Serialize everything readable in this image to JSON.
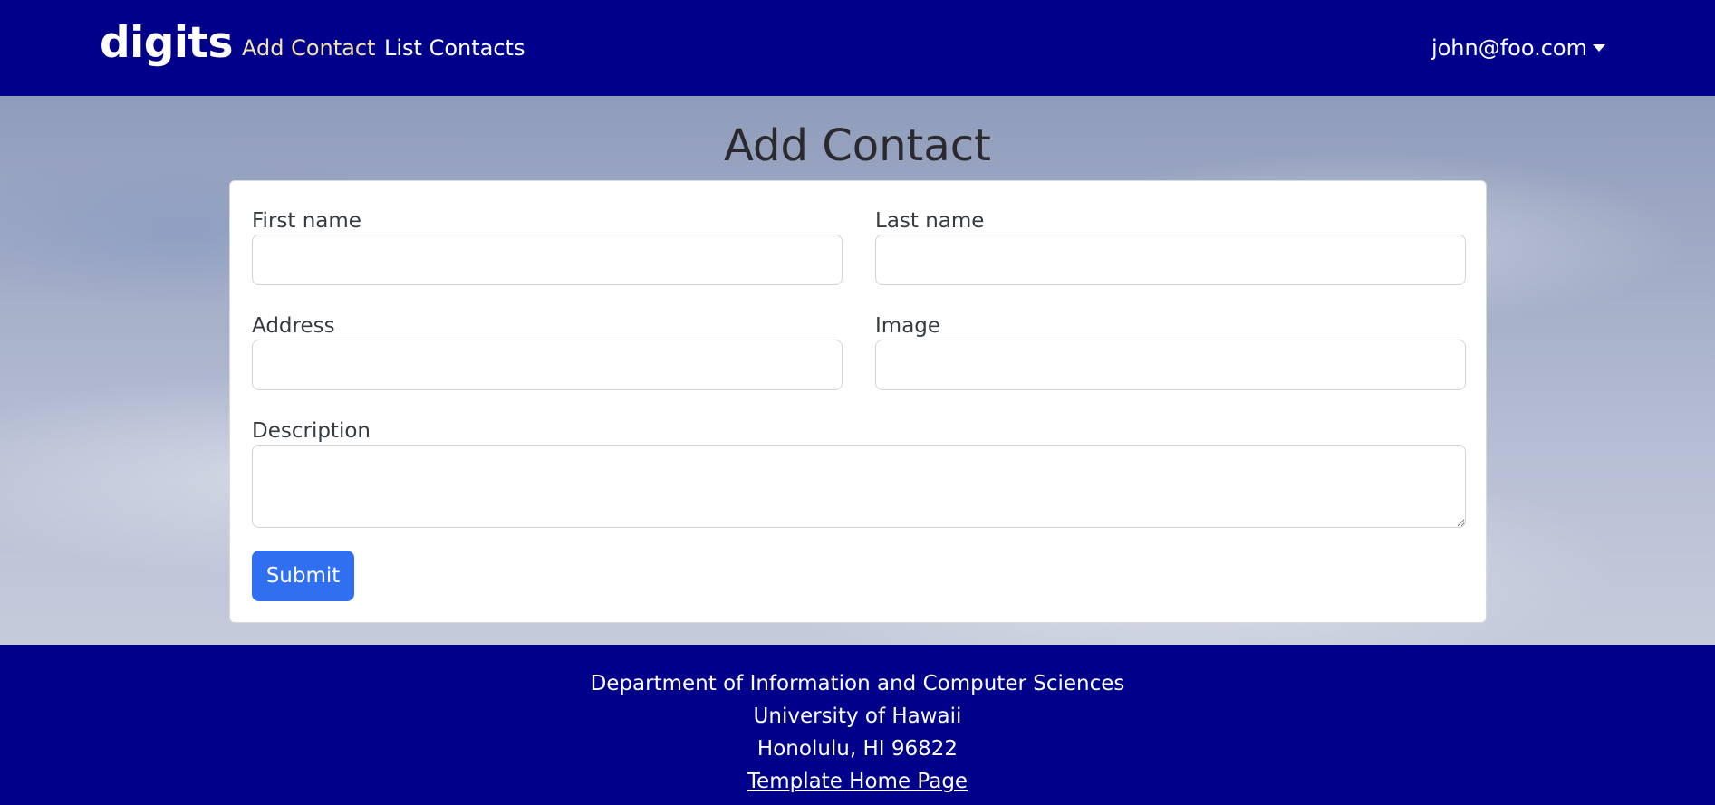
{
  "navbar": {
    "brand": "digits",
    "links": [
      {
        "label": "Add Contact",
        "active": true
      },
      {
        "label": "List Contacts",
        "active": false
      }
    ],
    "user": "john@foo.com"
  },
  "page": {
    "title": "Add Contact"
  },
  "form": {
    "first_name_label": "First name",
    "first_name_value": "",
    "last_name_label": "Last name",
    "last_name_value": "",
    "address_label": "Address",
    "address_value": "",
    "image_label": "Image",
    "image_value": "",
    "description_label": "Description",
    "description_value": "",
    "submit_label": "Submit"
  },
  "footer": {
    "line1": "Department of Information and Computer Sciences",
    "line2": "University of Hawaii",
    "line3": "Honolulu, HI 96822",
    "link": "Template Home Page"
  },
  "colors": {
    "navbar_bg": "#00008b",
    "active_link": "#f3e3a6",
    "submit_bg": "#2f6ff0"
  }
}
